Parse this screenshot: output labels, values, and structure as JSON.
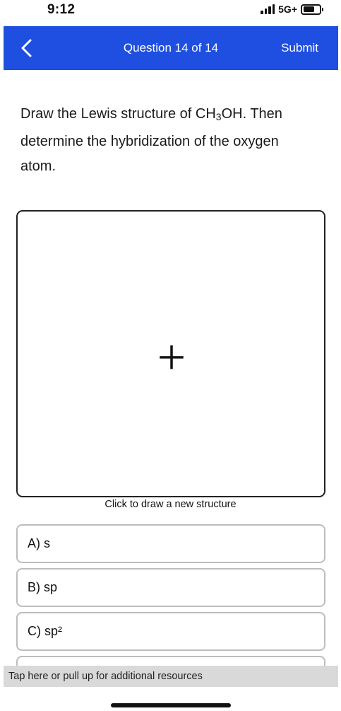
{
  "status_bar": {
    "time": "9:12",
    "network": "5G+"
  },
  "header": {
    "title": "Question 14 of 14",
    "submit_label": "Submit",
    "background": "#1f4fe0"
  },
  "question": {
    "text_prefix": "Draw the Lewis structure of CH",
    "subscript": "3",
    "text_suffix": "OH. Then determine the hybridization of the oxygen atom."
  },
  "drawing": {
    "caption": "Click to draw a new structure",
    "icon": "plus-icon"
  },
  "choices": [
    {
      "label": "A) s"
    },
    {
      "label": "B) sp"
    },
    {
      "label": "C) sp²"
    }
  ],
  "footer": {
    "resources_label": "Tap here or pull up for additional resources"
  }
}
